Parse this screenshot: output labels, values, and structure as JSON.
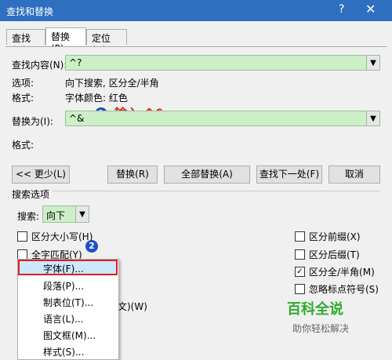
{
  "window": {
    "title": "查找和替换",
    "help": "?",
    "close": "✕"
  },
  "tabs": [
    {
      "label": "查找(D)"
    },
    {
      "label": "替换(P)"
    },
    {
      "label": "定位(G)"
    }
  ],
  "find": {
    "label": "查找内容(N):",
    "value": "^?"
  },
  "options_row": {
    "label": "选项:",
    "value": "向下搜索, 区分全/半角"
  },
  "format_row": {
    "label": "格式:",
    "value": "字体颜色: 红色"
  },
  "replace": {
    "label": "替换为(I):",
    "value": "^&"
  },
  "replace_format": {
    "label": "格式:"
  },
  "annotation1": {
    "badge": "1",
    "text": "输入 ^&"
  },
  "annotation2": {
    "badge": "2"
  },
  "buttons": {
    "less": "<< 更少(L)",
    "replace": "替换(R)",
    "replace_all": "全部替换(A)",
    "find_next": "查找下一处(F)",
    "cancel": "取消"
  },
  "search_options": {
    "heading": "搜索选项",
    "search_label": "搜索:",
    "search_value": "向下"
  },
  "checkboxes_left": [
    {
      "label": "区分大小写(H)",
      "checked": false
    },
    {
      "label": "全字匹配(Y)",
      "checked": false
    }
  ],
  "checkboxes_right": [
    {
      "label": "区分前缀(X)",
      "checked": false,
      "mark": ""
    },
    {
      "label": "区分后缀(T)",
      "checked": false,
      "mark": ""
    },
    {
      "label": "区分全/半角(M)",
      "checked": true,
      "mark": "✓"
    },
    {
      "label": "忽略标点符号(S)",
      "checked": false,
      "mark": ""
    }
  ],
  "hidden_partial": "文)(W)",
  "format_menu": [
    {
      "label": "字体(F)..."
    },
    {
      "label": "段落(P)..."
    },
    {
      "label": "制表位(T)..."
    },
    {
      "label": "语言(L)..."
    },
    {
      "label": "图文框(M)..."
    },
    {
      "label": "样式(S)..."
    }
  ],
  "watermark": {
    "title": "百科全说",
    "subtitle": "助你轻松解决"
  },
  "colors": {
    "titlebar": "#2e6fbf",
    "field_bg": "#ccefc8",
    "highlight_border": "#e02020",
    "annotation": "#e21d1d",
    "badge": "#1e4fc2"
  }
}
